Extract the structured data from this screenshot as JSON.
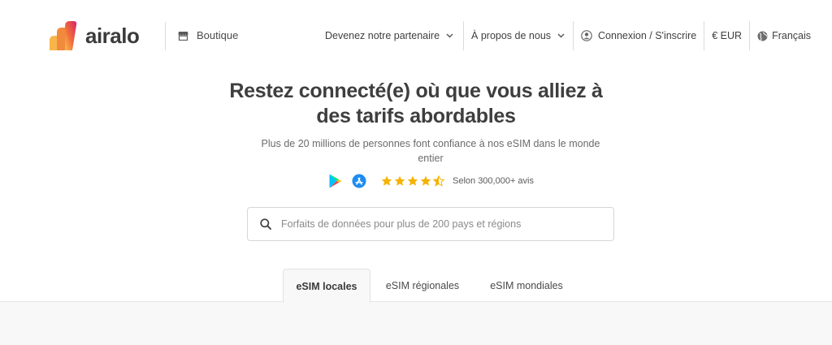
{
  "header": {
    "logo_text": "airalo",
    "shop_label": "Boutique",
    "nav": {
      "partner_label": "Devenez notre partenaire",
      "about_label": "À propos de nous",
      "login_label": "Connexion / S'inscrire",
      "currency_label": "€ EUR",
      "language_label": "Français"
    }
  },
  "hero": {
    "title_line1": "Restez connecté(e) où que vous alliez à",
    "title_line2": "des tarifs abordables",
    "subtitle": "Plus de 20 millions de personnes font confiance à nos eSIM dans le monde entier",
    "rating_stars": 4.5,
    "rating_text": "Selon 300,000+ avis"
  },
  "search": {
    "placeholder": "Forfaits de données pour plus de 200 pays et régions",
    "value": ""
  },
  "tabs": [
    {
      "label": "eSIM locales",
      "active": true
    },
    {
      "label": "eSIM régionales",
      "active": false
    },
    {
      "label": "eSIM mondiales",
      "active": false
    }
  ],
  "colors": {
    "star": "#f5b301",
    "logo_orange": "#f7a44b",
    "logo_red": "#e8413a",
    "logo_pink": "#d6236f"
  }
}
